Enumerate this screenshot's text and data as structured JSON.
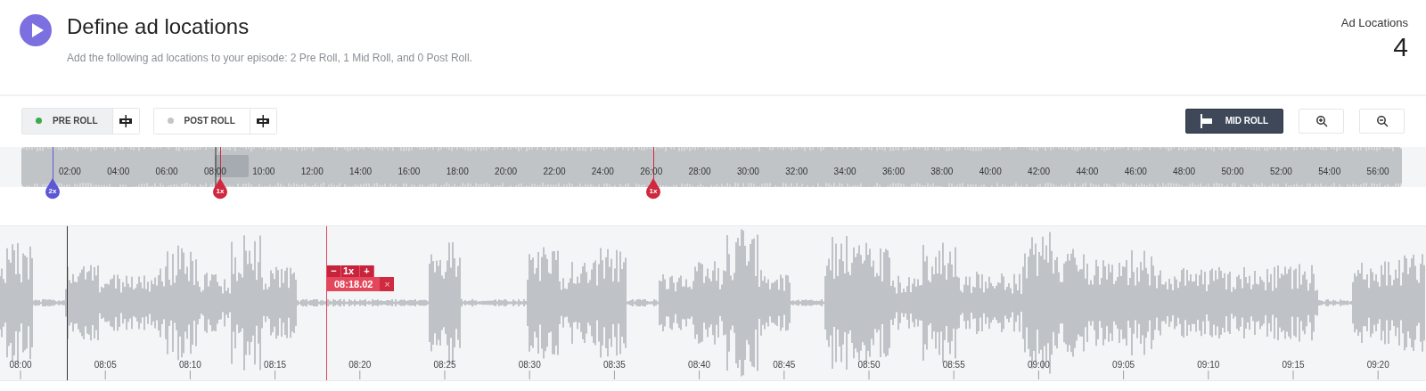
{
  "header": {
    "title": "Define ad locations",
    "subtitle": "Add the following ad locations to your episode: 2 Pre Roll, 1 Mid Roll, and 0 Post Roll.",
    "counter_label": "Ad Locations",
    "counter_value": "4"
  },
  "toolbar": {
    "roll_buttons": [
      {
        "label": "PRE ROLL",
        "selected": true,
        "color": "#3daa4f"
      },
      {
        "label": "POST ROLL",
        "selected": false,
        "color": "#c2c5c9"
      }
    ],
    "mid_roll_button": "MID ROLL"
  },
  "overview": {
    "ticks": [
      "02:00",
      "04:00",
      "06:00",
      "08:00",
      "10:00",
      "12:00",
      "14:00",
      "16:00",
      "18:00",
      "20:00",
      "22:00",
      "24:00",
      "26:00",
      "28:00",
      "30:00",
      "32:00",
      "34:00",
      "36:00",
      "38:00",
      "40:00",
      "42:00",
      "44:00",
      "46:00",
      "48:00",
      "50:00",
      "52:00",
      "54:00",
      "56:00"
    ],
    "markers": [
      {
        "label": "2x",
        "color": "#5b57d6"
      },
      {
        "label": "1x",
        "color": "#d0283e"
      },
      {
        "label": "1x",
        "color": "#d0283e"
      }
    ]
  },
  "detail": {
    "ticks": [
      "08:00",
      "08:05",
      "08:10",
      "08:15",
      "08:20",
      "08:25",
      "08:30",
      "08:35",
      "08:40",
      "08:45",
      "08:50",
      "08:55",
      "09:00",
      "09:05",
      "09:10",
      "09:15",
      "09:20"
    ],
    "marker": {
      "minus": "−",
      "count": "1x",
      "plus": "+",
      "time": "08:18.02",
      "remove": "×"
    }
  }
}
